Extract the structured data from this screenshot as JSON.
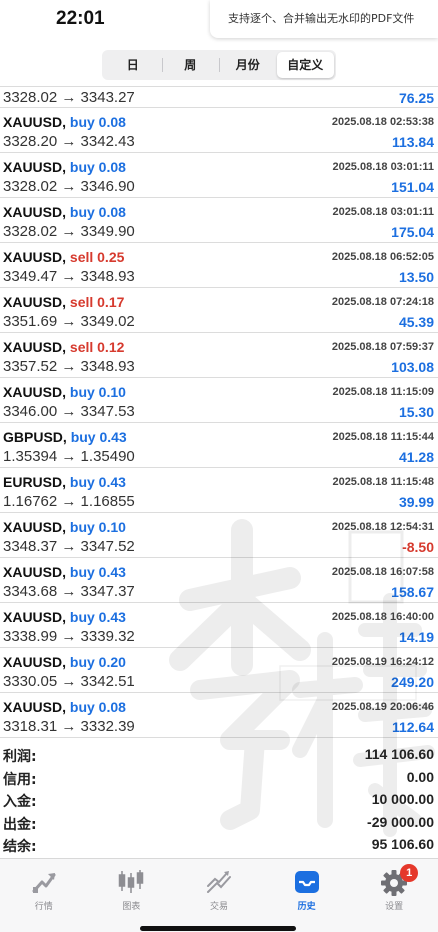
{
  "status": {
    "time": "22:01"
  },
  "banner": {
    "text": "支持逐个、合并输出无水印的PDF文件"
  },
  "segments": [
    {
      "label": "日",
      "active": false
    },
    {
      "label": "周",
      "active": false
    },
    {
      "label": "月份",
      "active": false
    },
    {
      "label": "自定义",
      "active": true
    }
  ],
  "first_row": {
    "prices": "3328.02 → 3343.27",
    "profit": "76.25"
  },
  "trades": [
    {
      "symbol": "XAUUSD,",
      "side": "buy",
      "volume": "buy 0.08",
      "time": "2025.08.18 02:53:38",
      "prices": "3328.20 → 3342.43",
      "profit": "113.84"
    },
    {
      "symbol": "XAUUSD,",
      "side": "buy",
      "volume": "buy 0.08",
      "time": "2025.08.18 03:01:11",
      "prices": "3328.02 → 3346.90",
      "profit": "151.04"
    },
    {
      "symbol": "XAUUSD,",
      "side": "buy",
      "volume": "buy 0.08",
      "time": "2025.08.18 03:01:11",
      "prices": "3328.02 → 3349.90",
      "profit": "175.04"
    },
    {
      "symbol": "XAUUSD,",
      "side": "sell",
      "volume": "sell 0.25",
      "time": "2025.08.18 06:52:05",
      "prices": "3349.47 → 3348.93",
      "profit": "13.50"
    },
    {
      "symbol": "XAUUSD,",
      "side": "sell",
      "volume": "sell 0.17",
      "time": "2025.08.18 07:24:18",
      "prices": "3351.69 → 3349.02",
      "profit": "45.39"
    },
    {
      "symbol": "XAUUSD,",
      "side": "sell",
      "volume": "sell 0.12",
      "time": "2025.08.18 07:59:37",
      "prices": "3357.52 → 3348.93",
      "profit": "103.08"
    },
    {
      "symbol": "XAUUSD,",
      "side": "buy",
      "volume": "buy 0.10",
      "time": "2025.08.18 11:15:09",
      "prices": "3346.00 → 3347.53",
      "profit": "15.30"
    },
    {
      "symbol": "GBPUSD,",
      "side": "buy",
      "volume": "buy 0.43",
      "time": "2025.08.18 11:15:44",
      "prices": "1.35394 → 1.35490",
      "profit": "41.28"
    },
    {
      "symbol": "EURUSD,",
      "side": "buy",
      "volume": "buy 0.43",
      "time": "2025.08.18 11:15:48",
      "prices": "1.16762 → 1.16855",
      "profit": "39.99"
    },
    {
      "symbol": "XAUUSD,",
      "side": "buy",
      "volume": "buy 0.10",
      "time": "2025.08.18 12:54:31",
      "prices": "3348.37 → 3347.52",
      "profit": "-8.50"
    },
    {
      "symbol": "XAUUSD,",
      "side": "buy",
      "volume": "buy 0.43",
      "time": "2025.08.18 16:07:58",
      "prices": "3343.68 → 3347.37",
      "profit": "158.67"
    },
    {
      "symbol": "XAUUSD,",
      "side": "buy",
      "volume": "buy 0.43",
      "time": "2025.08.18 16:40:00",
      "prices": "3338.99 → 3339.32",
      "profit": "14.19"
    },
    {
      "symbol": "XAUUSD,",
      "side": "buy",
      "volume": "buy 0.20",
      "time": "2025.08.19 16:24:12",
      "prices": "3330.05 → 3342.51",
      "profit": "249.20"
    },
    {
      "symbol": "XAUUSD,",
      "side": "buy",
      "volume": "buy 0.08",
      "time": "2025.08.19 20:06:46",
      "prices": "3318.31 → 3332.39",
      "profit": "112.64"
    }
  ],
  "summary": [
    {
      "label": "利润:",
      "value": "114 106.60"
    },
    {
      "label": "信用:",
      "value": "0.00"
    },
    {
      "label": "入金:",
      "value": "10 000.00"
    },
    {
      "label": "出金:",
      "value": "-29 000.00"
    },
    {
      "label": "结余:",
      "value": "95 106.60"
    }
  ],
  "tabs": [
    {
      "label": "行情",
      "icon": "quotes-icon",
      "active": false
    },
    {
      "label": "图表",
      "icon": "chart-icon",
      "active": false
    },
    {
      "label": "交易",
      "icon": "trade-icon",
      "active": false
    },
    {
      "label": "历史",
      "icon": "history-icon",
      "active": true
    },
    {
      "label": "设置",
      "icon": "settings-icon",
      "active": false,
      "badge": "1"
    }
  ],
  "colors": {
    "accent": "#1c6fe0",
    "negative": "#d63a2e"
  }
}
